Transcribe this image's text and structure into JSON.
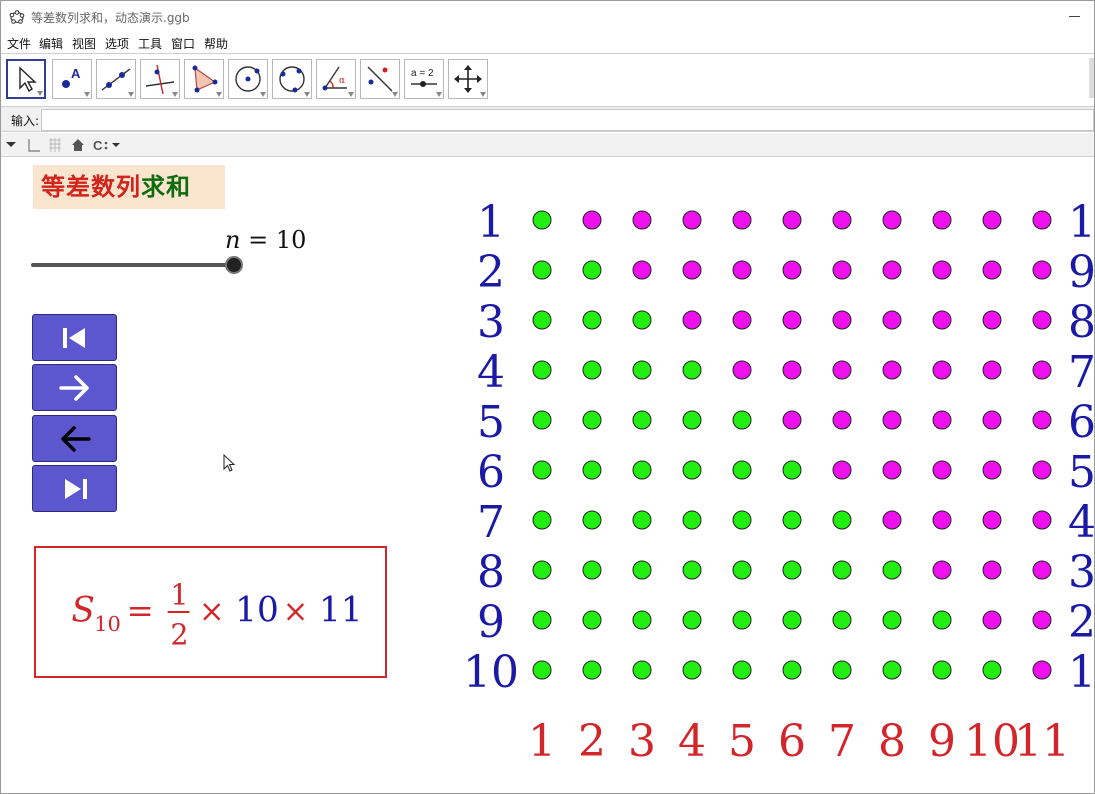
{
  "window": {
    "title": "等差数列求和，动态演示.ggb"
  },
  "menu": [
    "文件",
    "编辑",
    "视图",
    "选项",
    "工具",
    "窗口",
    "帮助"
  ],
  "toolbar": {
    "tools": [
      {
        "name": "move-tool-icon"
      },
      {
        "name": "point-tool-icon"
      },
      {
        "name": "line-tool-icon"
      },
      {
        "name": "perpendicular-line-tool-icon"
      },
      {
        "name": "polygon-tool-icon"
      },
      {
        "name": "circle-tool-icon"
      },
      {
        "name": "circle-three-points-tool-icon"
      },
      {
        "name": "angle-tool-icon"
      },
      {
        "name": "reflect-tool-icon"
      },
      {
        "name": "slider-tool-icon",
        "label": "a = 2"
      },
      {
        "name": "move-view-tool-icon"
      }
    ]
  },
  "input_bar": {
    "label": "输入:",
    "value": ""
  },
  "caption": {
    "part1": "等差数列",
    "part2": "求和"
  },
  "slider": {
    "var": "n",
    "eq": " = ",
    "value": "10",
    "fill_fraction": 1.0
  },
  "buttons": [
    "skip-to-start-icon",
    "step-forward-arrow-icon",
    "step-back-arrow-icon",
    "skip-to-end-icon"
  ],
  "formula": {
    "S": "S",
    "sub": "10",
    "eq": "=",
    "num": "1",
    "den": "2",
    "times": "×",
    "a": "10",
    "b": "11"
  },
  "grid": {
    "rows": 10,
    "cols": 11,
    "left_labels": [
      "1",
      "2",
      "3",
      "4",
      "5",
      "6",
      "7",
      "8",
      "9",
      "10"
    ],
    "right_labels": [
      "10",
      "9",
      "8",
      "7",
      "6",
      "5",
      "4",
      "3",
      "2",
      "1"
    ],
    "bottom_labels": [
      "1",
      "2",
      "3",
      "4",
      "5",
      "6",
      "7",
      "8",
      "9",
      "10",
      "11"
    ],
    "green_per_row": [
      1,
      2,
      3,
      4,
      5,
      6,
      7,
      8,
      9,
      10
    ]
  },
  "colors": {
    "green_dot": "#22ee11",
    "magenta_dot": "#ee11ee",
    "left_label": "#1a1aa6",
    "bottom_label": "#d3262b",
    "button": "#5d57cf"
  }
}
